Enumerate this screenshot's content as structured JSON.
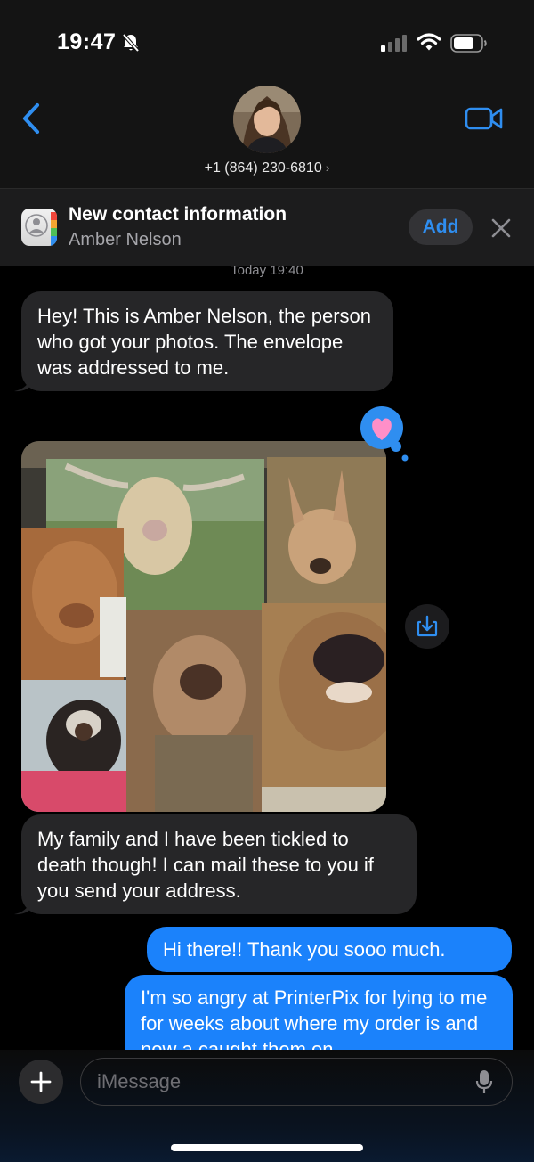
{
  "status_bar": {
    "time": "19:47",
    "icons": [
      "bell-slash-icon",
      "signal-icon",
      "wifi-icon",
      "battery-icon"
    ]
  },
  "header": {
    "phone_number": "+1 (864) 230-6810",
    "chevron": "›",
    "icons": [
      "back-chevron-icon",
      "avatar",
      "video-call-icon"
    ]
  },
  "banner": {
    "title": "New contact information",
    "subtitle": "Amber Nelson",
    "add_label": "Add"
  },
  "timestamp": "Today 19:40",
  "messages": [
    {
      "direction": "incoming",
      "text": "Hey! This is Amber Nelson, the person who got your photos. The envelope was addressed to me."
    },
    {
      "direction": "incoming",
      "type": "photo",
      "reaction": "heart"
    },
    {
      "direction": "incoming",
      "text": "My family and I have been tickled to death though! I can mail these to you if you send your address."
    },
    {
      "direction": "outgoing",
      "text": "Hi there!! Thank you sooo much."
    },
    {
      "direction": "outgoing",
      "text": "I'm so angry at PrinterPix for lying to me for weeks about where my order is and now a caught them on"
    }
  ],
  "composer": {
    "placeholder": "iMessage"
  },
  "colors": {
    "accent": "#1b82fb",
    "incoming_bubble": "#262628",
    "background": "#000000"
  }
}
